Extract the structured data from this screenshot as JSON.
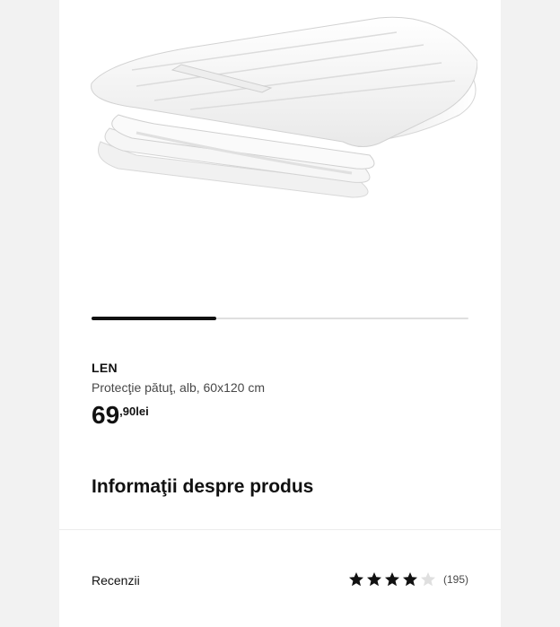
{
  "product": {
    "name": "LEN",
    "description": "Protecţie pătuţ, alb, 60x120 cm",
    "price_integer": "69",
    "price_decimal": ",90",
    "price_currency": "lei",
    "image_icon": "bumper-pad-image"
  },
  "carousel": {
    "progress": 0.33,
    "track_color": "#dfdfdf",
    "thumb_color": "#111111"
  },
  "info_section": {
    "title": "Informaţii despre produs"
  },
  "reviews": {
    "label": "Recenzii",
    "rating": 4,
    "max_rating": 5,
    "count": "(195)",
    "star_filled_color": "#111111",
    "star_empty_color": "#dfdfdf"
  }
}
